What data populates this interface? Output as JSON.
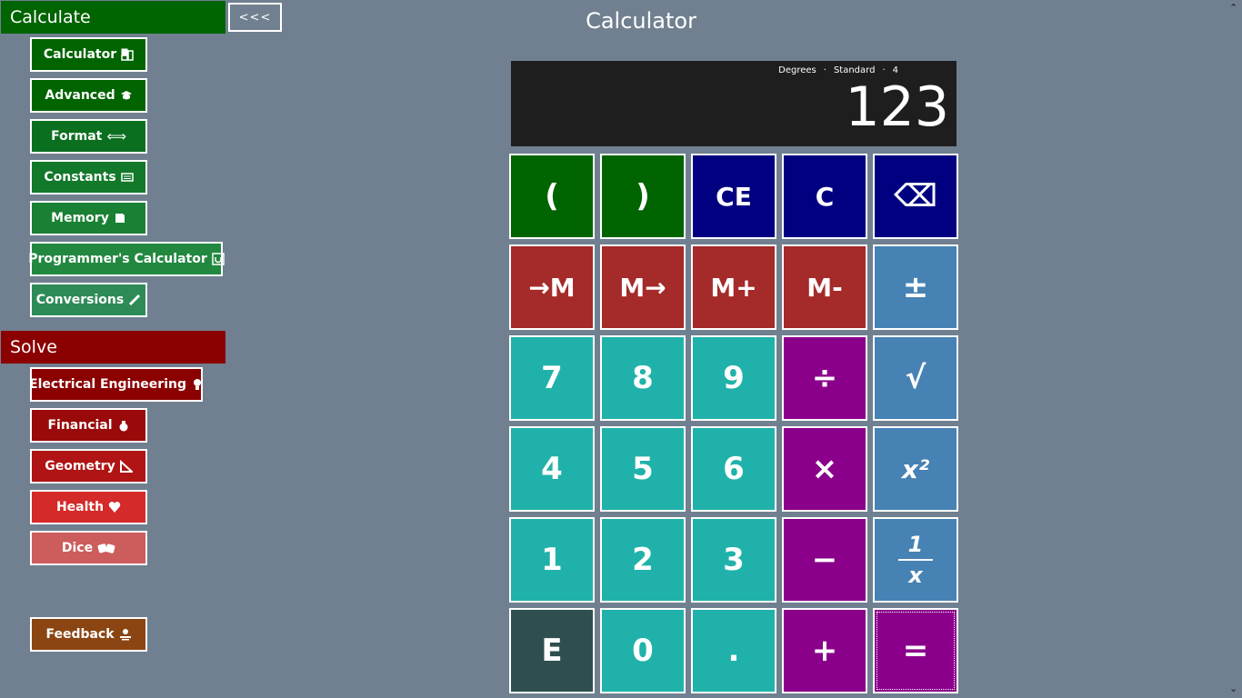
{
  "sidebar": {
    "collapse_label": "<<<",
    "calculate": {
      "header": "Calculate",
      "header_color": "#006400",
      "items": [
        {
          "label": "Calculator",
          "icon": "calculator-icon",
          "color": "#006400"
        },
        {
          "label": "Advanced",
          "icon": "graduation-cap-icon",
          "color": "#006400"
        },
        {
          "label": "Format",
          "icon": "double-arrow-icon",
          "color": "#0a7020"
        },
        {
          "label": "Constants",
          "icon": "list-icon",
          "color": "#12782a"
        },
        {
          "label": "Memory",
          "icon": "memory-icon",
          "color": "#1a8034"
        },
        {
          "label": "Programmer's Calculator",
          "icon": "chip-icon",
          "color": "#228840"
        },
        {
          "label": "Conversions",
          "icon": "pencil-icon",
          "color": "#2e8b57"
        }
      ]
    },
    "solve": {
      "header": "Solve",
      "header_color": "#8b0000",
      "items": [
        {
          "label": "Electrical Engineering",
          "icon": "lightbulb-icon",
          "color": "#8b0000"
        },
        {
          "label": "Financial",
          "icon": "money-bag-icon",
          "color": "#9a0a0a"
        },
        {
          "label": "Geometry",
          "icon": "set-square-icon",
          "color": "#b01414"
        },
        {
          "label": "Health",
          "icon": "heart-icon",
          "color": "#d42a2a"
        },
        {
          "label": "Dice",
          "icon": "dice-icon",
          "color": "#cd5c5c"
        }
      ]
    },
    "feedback": {
      "label": "Feedback",
      "icon": "feedback-icon",
      "color": "#8b4513"
    }
  },
  "main": {
    "title": "Calculator",
    "display": {
      "angle_mode": "Degrees",
      "mode": "Standard",
      "precision": "4",
      "separator": "·",
      "value": "123"
    },
    "keys": {
      "open_paren": "(",
      "close_paren": ")",
      "clear_entry": "CE",
      "clear": "C",
      "backspace": "⌫",
      "memory_store": "→M",
      "memory_recall": "M→",
      "memory_add": "M+",
      "memory_subtract": "M-",
      "plus_minus": "±",
      "seven": "7",
      "eight": "8",
      "nine": "9",
      "divide": "÷",
      "sqrt": "√",
      "four": "4",
      "five": "5",
      "six": "6",
      "multiply": "×",
      "square": "x²",
      "one": "1",
      "two": "2",
      "three": "3",
      "minus": "−",
      "reciprocal_num": "1",
      "reciprocal_den": "x",
      "exponent": "E",
      "zero": "0",
      "decimal": ".",
      "plus": "+",
      "equals": "="
    }
  }
}
